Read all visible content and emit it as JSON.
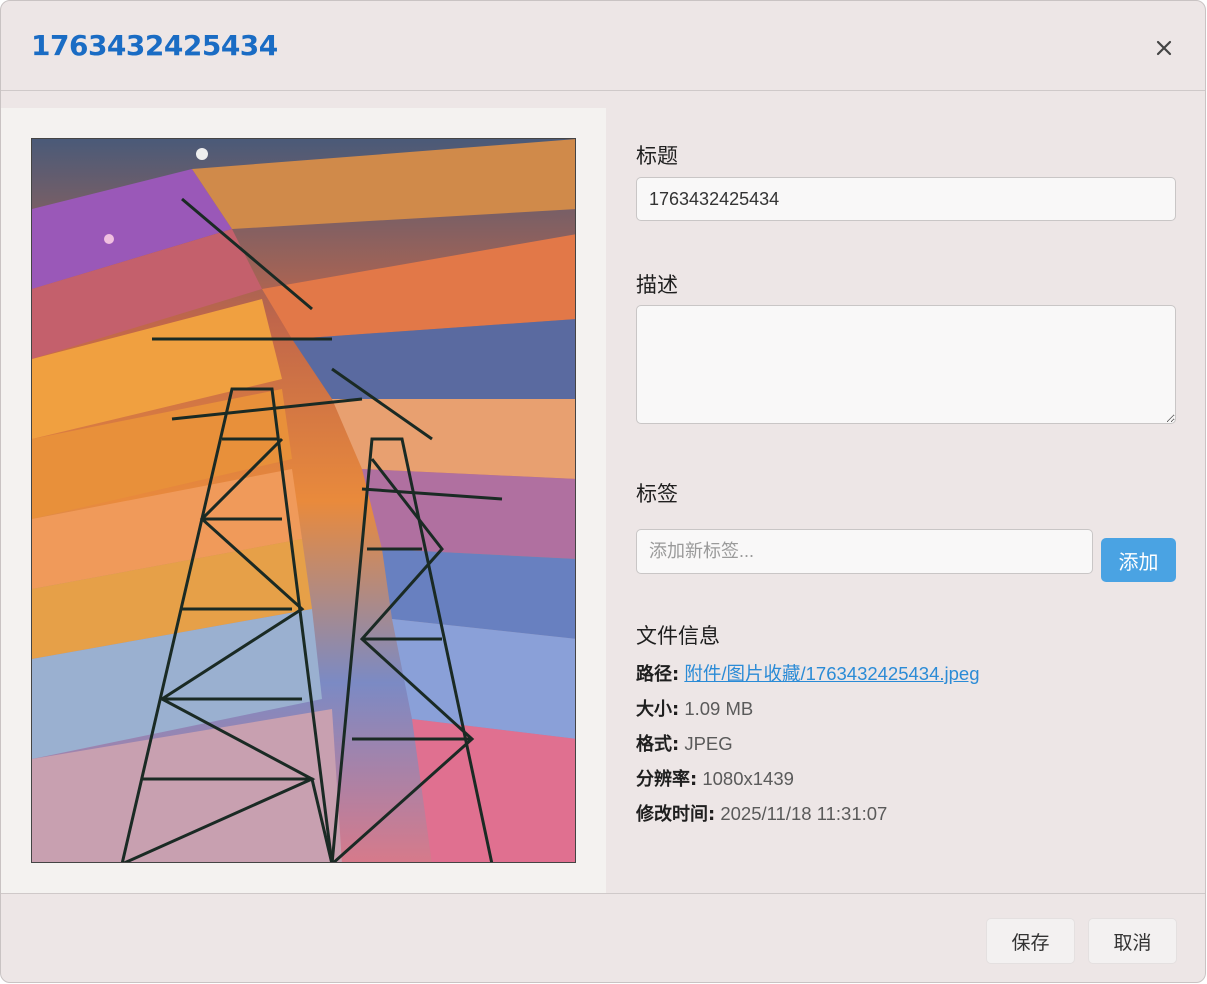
{
  "header": {
    "title": "1763432425434",
    "close_icon": "close-icon"
  },
  "form": {
    "title_label": "标题",
    "title_value": "1763432425434",
    "desc_label": "描述",
    "desc_value": "",
    "tags_label": "标签",
    "tag_placeholder": "添加新标签...",
    "add_button": "添加"
  },
  "file_info": {
    "heading": "文件信息",
    "path_key": "路径:",
    "path_value": "附件/图片收藏/1763432425434.jpeg",
    "size_key": "大小:",
    "size_value": "1.09 MB",
    "format_key": "格式:",
    "format_value": "JPEG",
    "resolution_key": "分辨率:",
    "resolution_value": "1080x1439",
    "modified_key": "修改时间:",
    "modified_value": "2025/11/18 11:31:07"
  },
  "footer": {
    "save_button": "保存",
    "cancel_button": "取消"
  },
  "colors": {
    "accent": "#1a6cc4",
    "add_button": "#4aa3e3",
    "link": "#2b8bd6"
  }
}
